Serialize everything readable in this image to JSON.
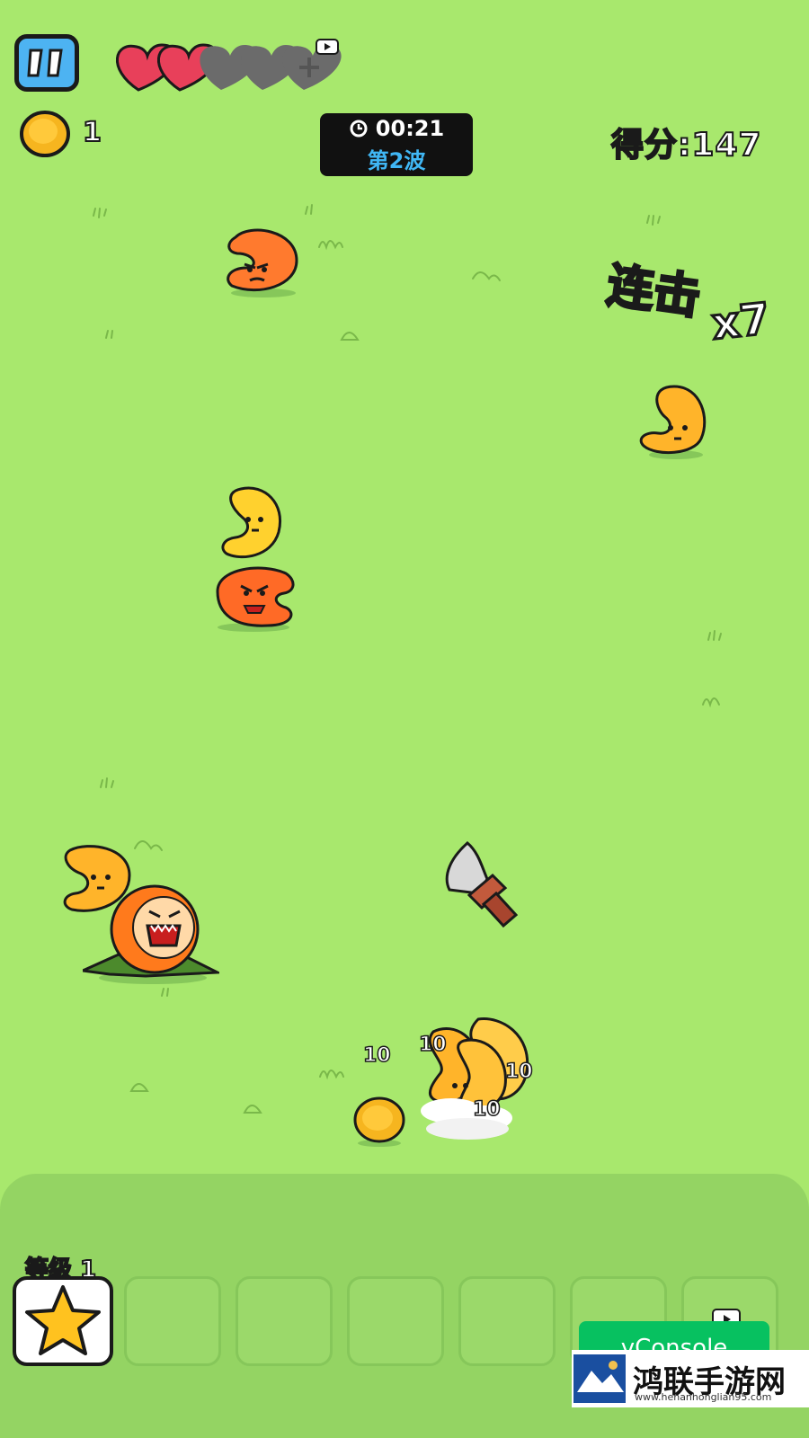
{
  "hud": {
    "pause_icon": "pause-icon",
    "coins": "1",
    "timer": "00:21",
    "wave": "第2波",
    "score_label": "得分:",
    "score_value": "147",
    "combo_label": "连击",
    "combo_mult": "x7"
  },
  "health": {
    "full_hearts": 2,
    "empty_hearts": 3
  },
  "damage_numbers": [
    "10",
    "10",
    "10",
    "10"
  ],
  "inventory": {
    "level_label": "等级 1",
    "slots": 6
  },
  "overlay": {
    "vconsole": "vConsole",
    "watermark": "鸿联手游网",
    "watermark_url": "www.henanhonglian95.com"
  },
  "colors": {
    "background": "#a8e86d",
    "accent_blue": "#4db3f2",
    "combo_yellow": "#ffe23a",
    "heart_red": "#e8405a"
  }
}
